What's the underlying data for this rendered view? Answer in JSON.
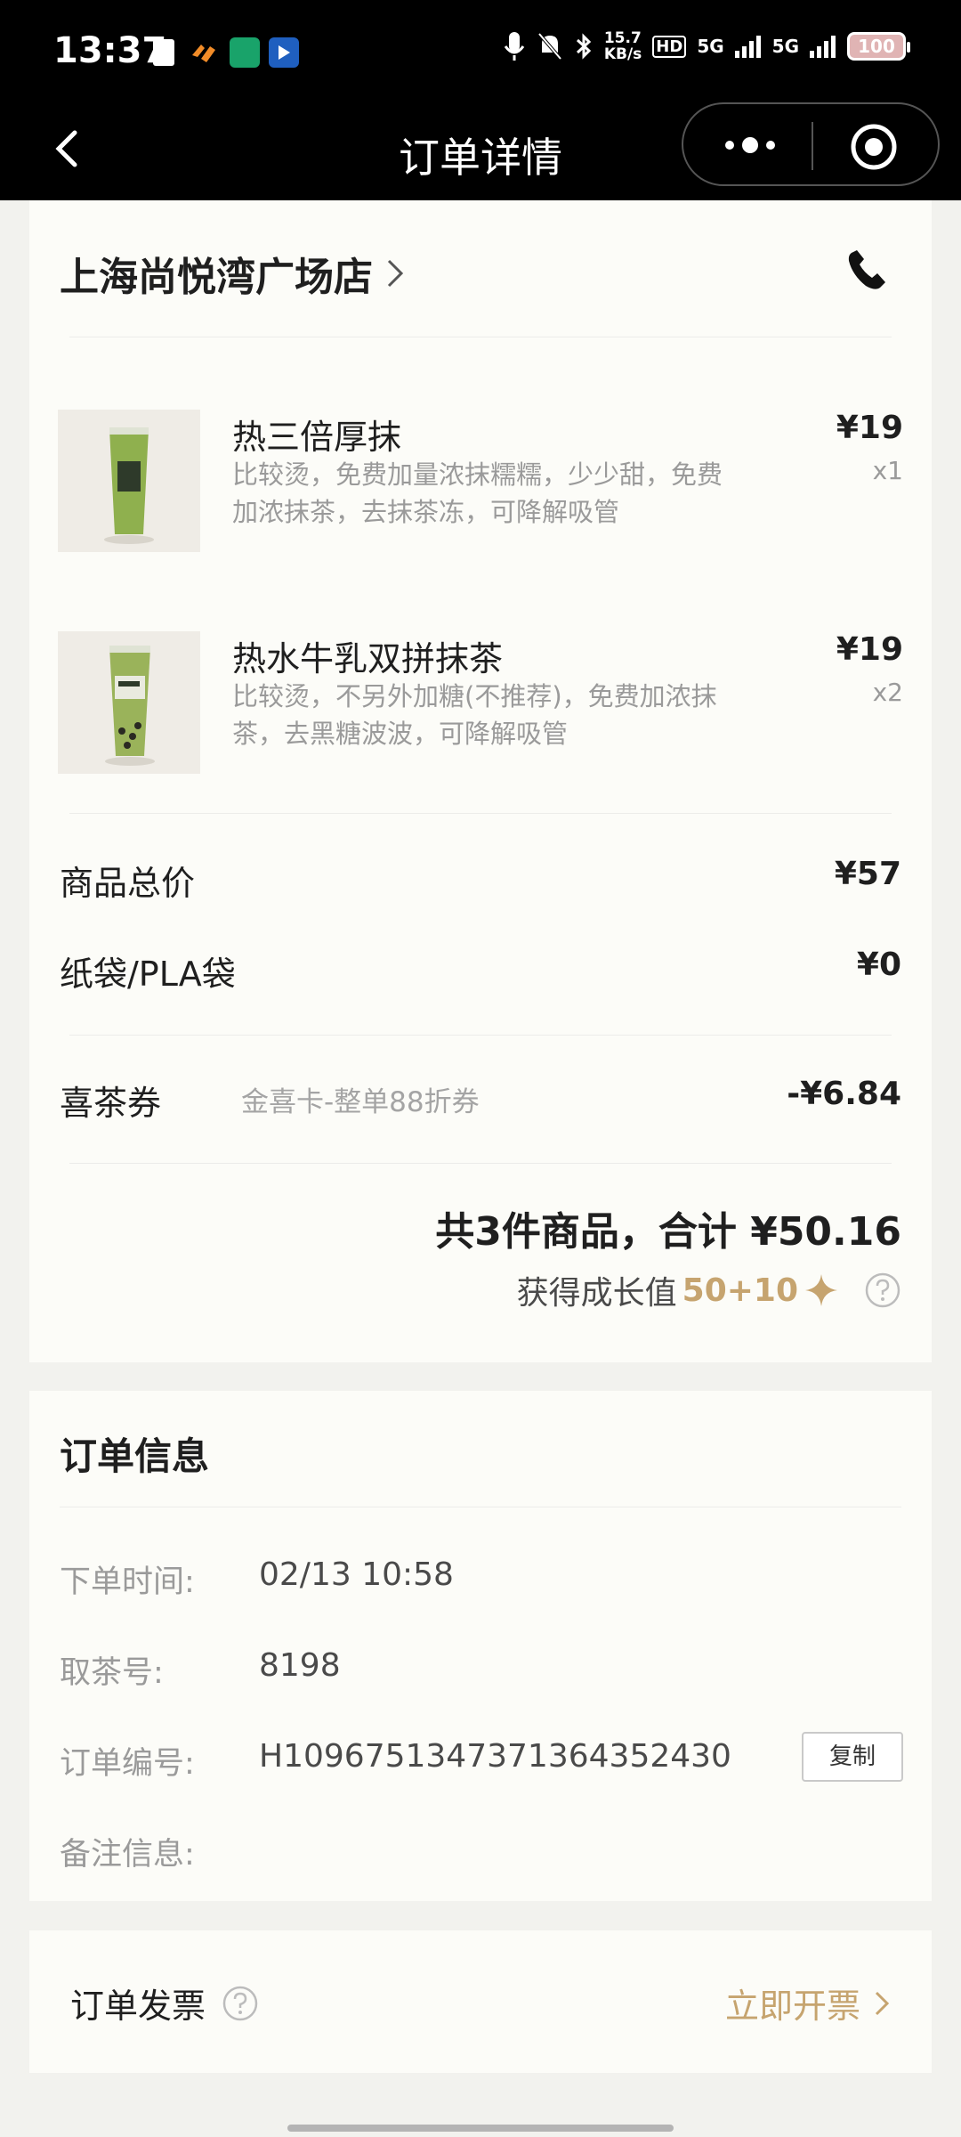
{
  "status_bar": {
    "time": "13:37",
    "speed_value": "15.7",
    "speed_unit": "KB/s",
    "hd": "HD",
    "net1": "5G",
    "net2": "5G",
    "battery": "100"
  },
  "nav": {
    "title": "订单详情"
  },
  "store": {
    "name": "上海尚悦湾广场店"
  },
  "items": [
    {
      "name": "热三倍厚抹",
      "desc": "比较烫，免费加量浓抹糯糯，少少甜，免费加浓抹茶，去抹茶冻，可降解吸管",
      "price": "¥19",
      "qty": "x1"
    },
    {
      "name": "热水牛乳双拼抹茶",
      "desc": "比较烫，不另外加糖(不推荐)，免费加浓抹茶，去黑糖波波，可降解吸管",
      "price": "¥19",
      "qty": "x2"
    }
  ],
  "summary": {
    "goods_total_label": "商品总价",
    "goods_total_value": "¥57",
    "bag_label": "纸袋/PLA袋",
    "bag_value": "¥0",
    "coupon_label": "喜茶券",
    "coupon_desc": "金喜卡-整单88折券",
    "coupon_value": "-¥6.84",
    "total_text": "共3件商品，合计 ¥50.16",
    "growth_label": "获得成长值",
    "growth_value": "50+10"
  },
  "order_info": {
    "title": "订单信息",
    "rows": [
      {
        "label": "下单时间:",
        "value": "02/13 10:58"
      },
      {
        "label": "取茶号:",
        "value": "8198"
      },
      {
        "label": "订单编号:",
        "value": "H1096751347371364352430"
      },
      {
        "label": "备注信息:",
        "value": ""
      }
    ],
    "copy_label": "复制"
  },
  "invoice": {
    "label": "订单发票",
    "action": "立即开票"
  },
  "colors": {
    "accent_gold": "#c6a46f",
    "matcha": "#8aa94b"
  }
}
